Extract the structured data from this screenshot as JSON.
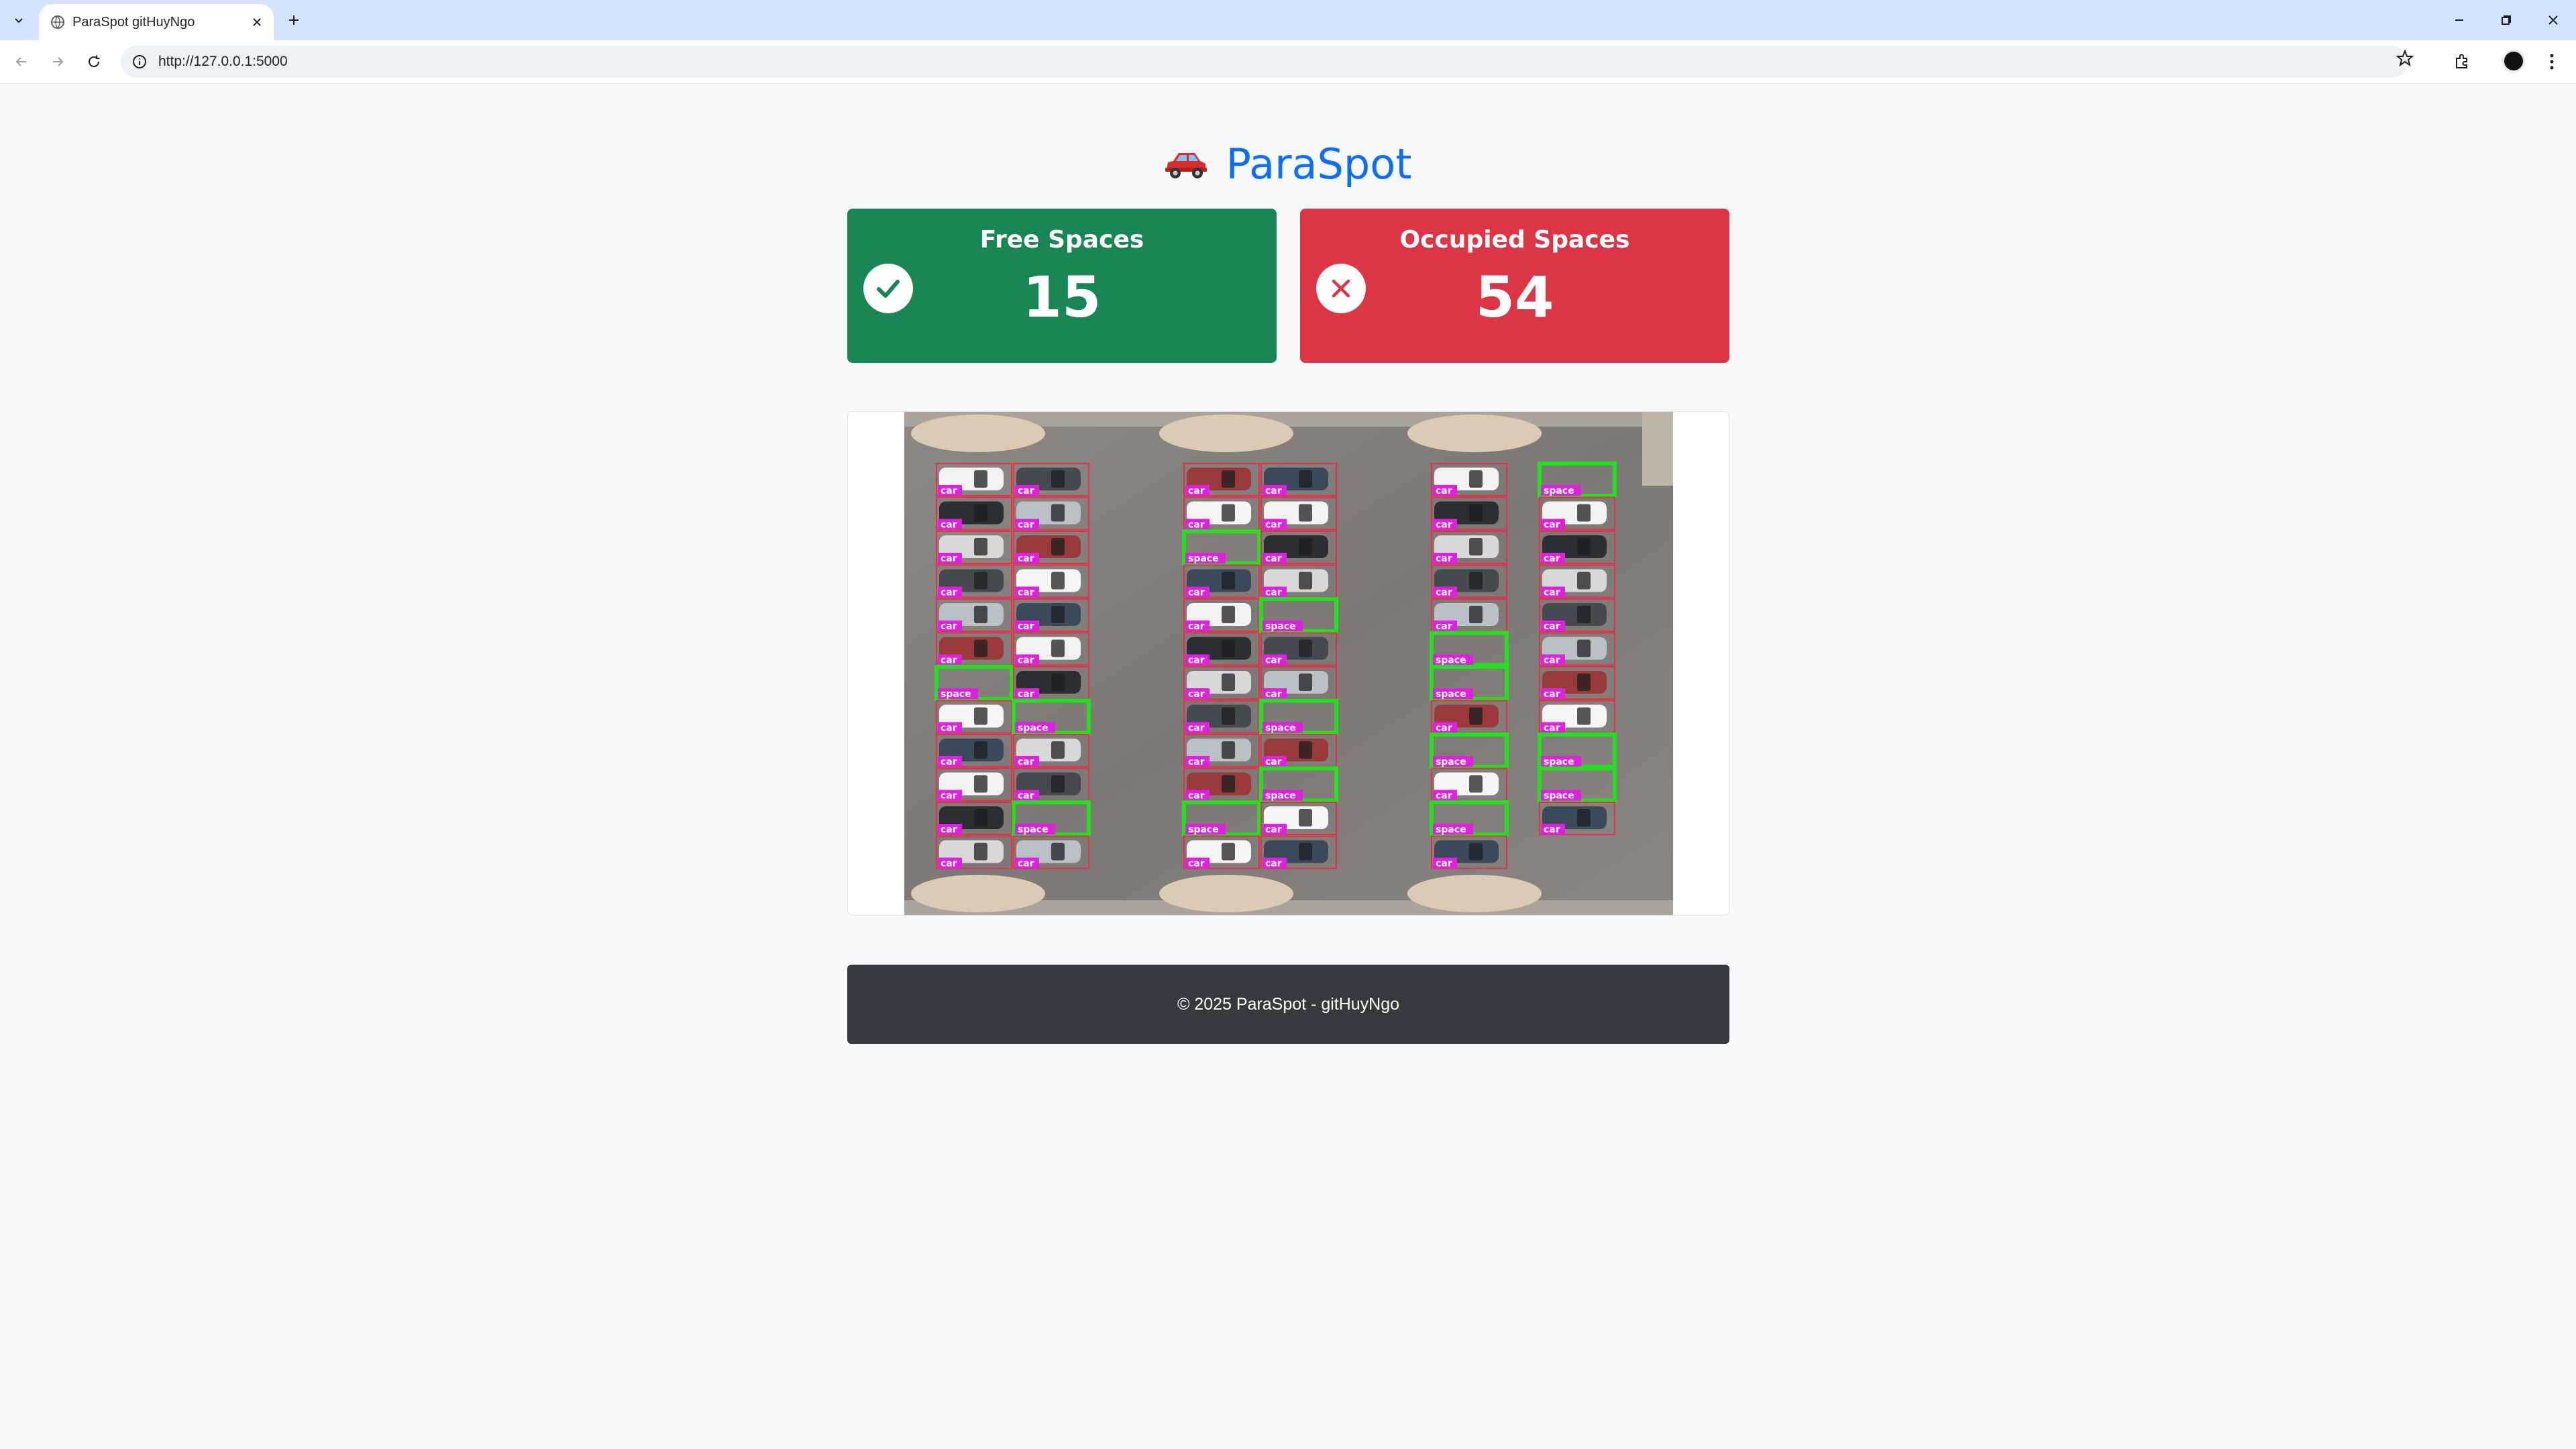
{
  "browser": {
    "tab_title": "ParaSpot gitHuyNgo",
    "url": "http://127.0.0.1:5000"
  },
  "app": {
    "title": "ParaSpot",
    "logo_icon": "car-icon"
  },
  "stats": {
    "free_label": "Free Spaces",
    "free_value": "15",
    "free_icon": "check-circle-icon",
    "free_color": "#198754",
    "occupied_label": "Occupied Spaces",
    "occupied_value": "54",
    "occupied_icon": "x-circle-icon",
    "occupied_color": "#dc3545"
  },
  "detection": {
    "car_label": "car",
    "space_label": "space",
    "car_box_color": "#e0334a",
    "space_box_color": "#22e01e",
    "label_bg_color": "#e020e0"
  },
  "footer": {
    "text": "© 2025 ParaSpot - gitHuyNgo"
  }
}
